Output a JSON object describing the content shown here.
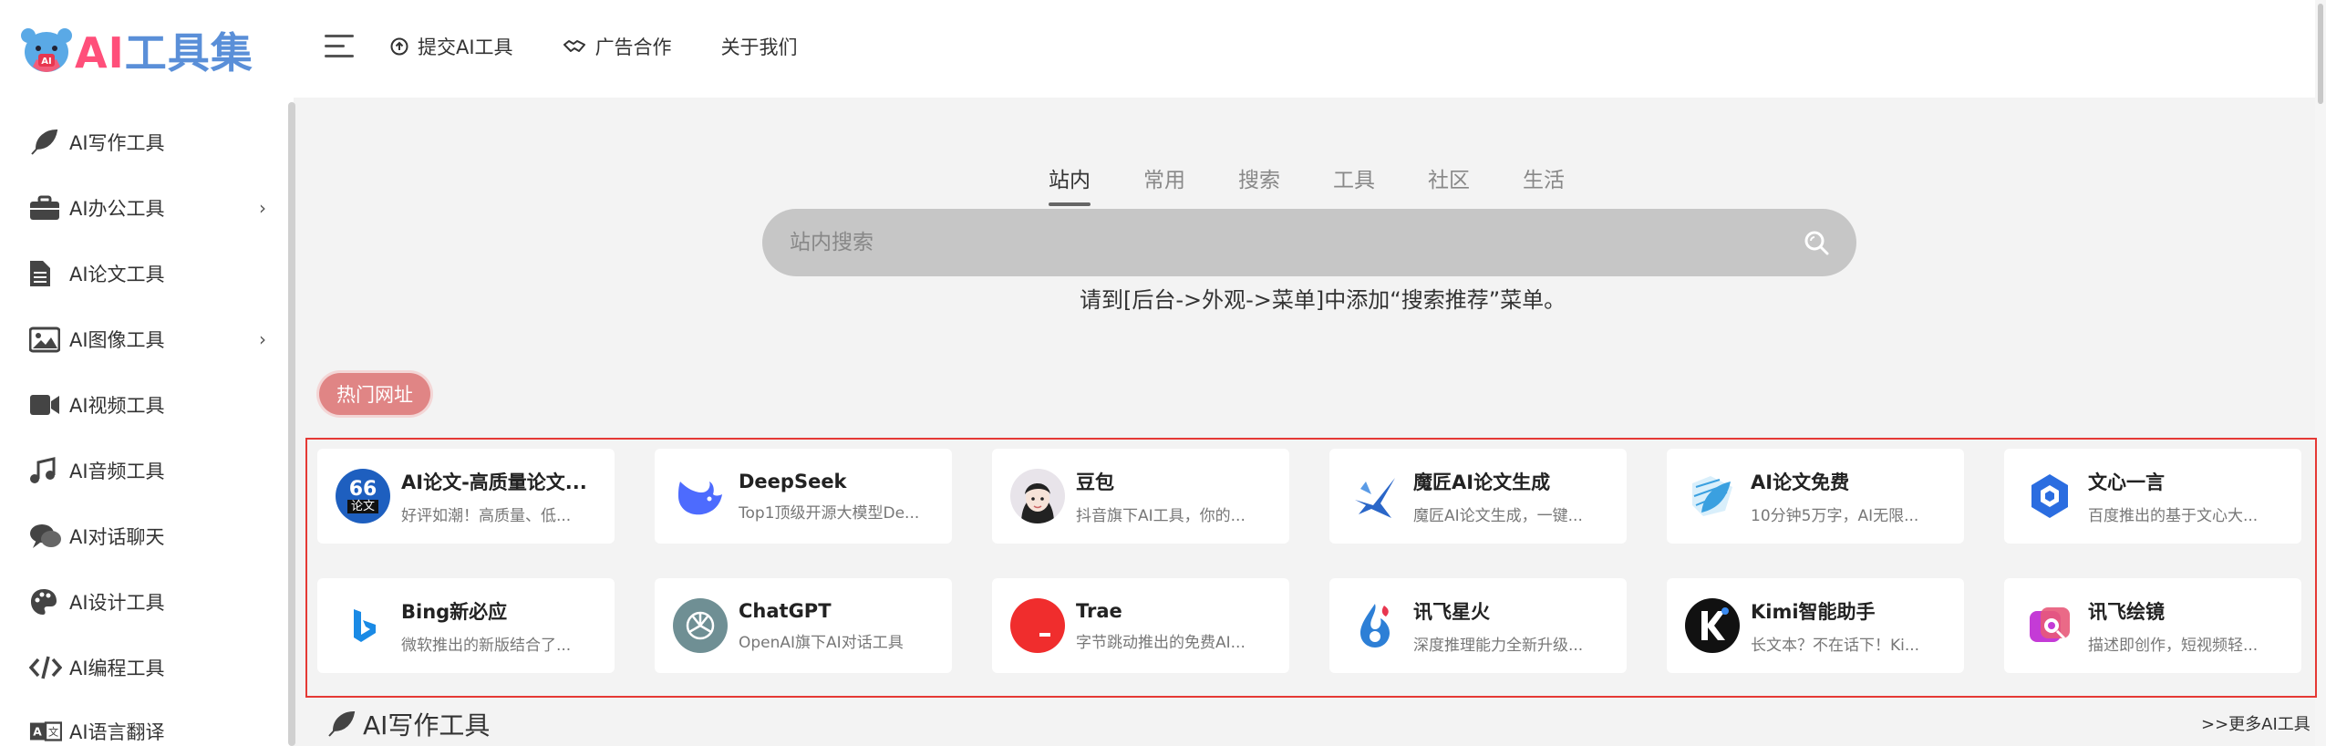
{
  "header": {
    "logo_ai": "AI",
    "logo_rest": "工具集",
    "logo_badge": "AI",
    "nav": [
      {
        "label": "提交AI工具",
        "icon": "upload-icon"
      },
      {
        "label": "广告合作",
        "icon": "handshake-icon"
      },
      {
        "label": "关于我们",
        "icon": ""
      }
    ]
  },
  "sidebar": {
    "items": [
      {
        "label": "AI写作工具",
        "icon": "feather-icon",
        "has_sub": false
      },
      {
        "label": "AI办公工具",
        "icon": "briefcase-icon",
        "has_sub": true
      },
      {
        "label": "AI论文工具",
        "icon": "document-icon",
        "has_sub": false
      },
      {
        "label": "AI图像工具",
        "icon": "image-icon",
        "has_sub": true
      },
      {
        "label": "AI视频工具",
        "icon": "video-icon",
        "has_sub": false
      },
      {
        "label": "AI音频工具",
        "icon": "music-icon",
        "has_sub": false
      },
      {
        "label": "AI对话聊天",
        "icon": "chat-icon",
        "has_sub": false
      },
      {
        "label": "AI设计工具",
        "icon": "palette-icon",
        "has_sub": false
      },
      {
        "label": "AI编程工具",
        "icon": "code-icon",
        "has_sub": false
      },
      {
        "label": "AI语言翻译",
        "icon": "translate-icon",
        "has_sub": false
      }
    ]
  },
  "search": {
    "tabs": [
      "站内",
      "常用",
      "搜索",
      "工具",
      "社区",
      "生活"
    ],
    "active_tab": "站内",
    "placeholder": "站内搜索",
    "hint": "请到[后台->外观->菜单]中添加“搜索推荐”菜单。"
  },
  "hot": {
    "badge": "热门网址",
    "cards": [
      {
        "title": "AI论文-高质量论文...",
        "desc": "好评如潮！高质量、低...",
        "icon": "lunwen66-icon",
        "color": "#1e5fbf",
        "glyph": "66"
      },
      {
        "title": "DeepSeek",
        "desc": "Top1顶级开源大模型De...",
        "icon": "deepseek-whale-icon",
        "color": "#4d6bfe",
        "glyph": ""
      },
      {
        "title": "豆包",
        "desc": "抖音旗下AI工具，你的...",
        "icon": "doubao-avatar-icon",
        "color": "#e8e4ea",
        "glyph": ""
      },
      {
        "title": "魔匠AI论文生成",
        "desc": "魔匠AI论文生成，一键...",
        "icon": "mojiang-bird-icon",
        "color": "#2a66c8",
        "glyph": ""
      },
      {
        "title": "AI论文免费",
        "desc": "10分钟5万字，AI无限...",
        "icon": "ai-lunwen-leaf-icon",
        "color": "#3aa0e0",
        "glyph": ""
      },
      {
        "title": "文心一言",
        "desc": "百度推出的基于文心大...",
        "icon": "wenxin-hex-icon",
        "color": "#2b6de0",
        "glyph": ""
      },
      {
        "title": "Bing新必应",
        "desc": "微软推出的新版结合了...",
        "icon": "bing-icon",
        "color": "#1a8ae5",
        "glyph": "b"
      },
      {
        "title": "ChatGPT",
        "desc": "OpenAI旗下AI对话工具",
        "icon": "chatgpt-icon",
        "color": "#6f8f94",
        "glyph": ""
      },
      {
        "title": "Trae",
        "desc": "字节跳动推出的免费AI...",
        "icon": "trae-icon",
        "color": "#f02d2d",
        "glyph": "_"
      },
      {
        "title": "讯飞星火",
        "desc": "深度推理能力全新升级...",
        "icon": "xunfei-spark-icon",
        "color": "#2d7fd6",
        "glyph": ""
      },
      {
        "title": "Kimi智能助手",
        "desc": "长文本？不在话下！Ki...",
        "icon": "kimi-icon",
        "color": "#111111",
        "glyph": "K"
      },
      {
        "title": "讯飞绘镜",
        "desc": "描述即创作，短视频轻...",
        "icon": "xunfei-huijing-icon",
        "color": "#c43bd6",
        "glyph": ""
      }
    ]
  },
  "section": {
    "title": "AI写作工具",
    "more": ">>更多AI工具"
  }
}
